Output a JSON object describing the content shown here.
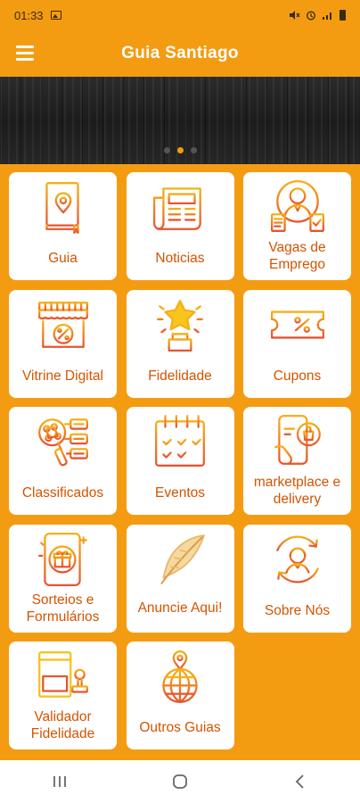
{
  "status": {
    "time": "01:33",
    "signal_text": "⁴ᴳ ᵢₗ"
  },
  "app": {
    "title": "Guia Santiago"
  },
  "banner": {
    "slides": 3,
    "active_slide": 2
  },
  "tiles": [
    {
      "label": "Guia",
      "icon": "guide-book-icon"
    },
    {
      "label": "Noticias",
      "icon": "newspaper-icon"
    },
    {
      "label": "Vagas de Emprego",
      "icon": "job-vacancy-icon"
    },
    {
      "label": "Vitrine Digital",
      "icon": "storefront-icon"
    },
    {
      "label": "Fidelidade",
      "icon": "trophy-star-icon"
    },
    {
      "label": "Cupons",
      "icon": "coupon-icon"
    },
    {
      "label": "Classificados",
      "icon": "magnifier-list-icon"
    },
    {
      "label": "Eventos",
      "icon": "calendar-icon"
    },
    {
      "label": "marketplace e delivery",
      "icon": "phone-shopping-icon"
    },
    {
      "label": "Sorteios e Formulários",
      "icon": "phone-gift-icon"
    },
    {
      "label": "Anuncie Aqui!",
      "icon": "feather-icon"
    },
    {
      "label": "Sobre Nós",
      "icon": "support-agent-icon"
    },
    {
      "label": "Validador Fidelidade",
      "icon": "stamp-card-icon"
    },
    {
      "label": "Outros Guias",
      "icon": "globe-pin-icon"
    }
  ],
  "colors": {
    "accent": "#f39c12",
    "label": "#d35400",
    "icon_gradient": [
      "#f5a623",
      "#e74c3c"
    ]
  }
}
